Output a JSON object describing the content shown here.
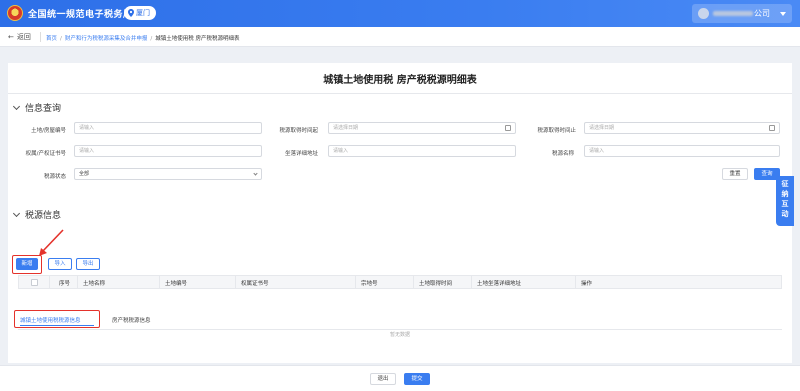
{
  "header": {
    "title": "全国统一规范电子税务局",
    "city": "厦门",
    "company_suffix": "公司",
    "colors": {
      "primary": "#3a7df0",
      "highlight": "#e4322b"
    }
  },
  "breadcrumb": {
    "back_label": "返回",
    "items": [
      "首页",
      "财产和行为税税源采集及合并申报",
      "城镇土地使用税 房产税税源明细表"
    ]
  },
  "page": {
    "title": "城镇土地使用税 房产税税源明细表"
  },
  "query": {
    "section_title": "信息查询",
    "fields": [
      {
        "label": "土地/房屋编号",
        "placeholder": "请输入"
      },
      {
        "label": "税源取得时间起",
        "placeholder": "请选择日期"
      },
      {
        "label": "税源取得时间止",
        "placeholder": "请选择日期"
      },
      {
        "label": "权属/产权证书号",
        "placeholder": "请输入"
      },
      {
        "label": "坐落详细地址",
        "placeholder": "请输入"
      },
      {
        "label": "税源名称",
        "placeholder": "请输入"
      },
      {
        "label": "税源状态",
        "value": "全部"
      }
    ],
    "reset_label": "重置",
    "search_label": "查询"
  },
  "tax_source": {
    "section_title": "税源信息",
    "new_label": "新增",
    "import_label": "导入",
    "export_label": "导出",
    "tabs": [
      {
        "label": "城镇土地使用税税源信息",
        "active": true
      },
      {
        "label": "房产税税源信息",
        "active": false
      }
    ],
    "columns": [
      "序号",
      "土地名称",
      "土地编号",
      "权属证书号",
      "宗地号",
      "土地取得时间",
      "土地坐落详细地址",
      "操作"
    ],
    "empty_text": "暂无数据"
  },
  "side_float": {
    "label": "征纳互动"
  },
  "footer": {
    "exit_label": "退出",
    "submit_label": "提交"
  }
}
